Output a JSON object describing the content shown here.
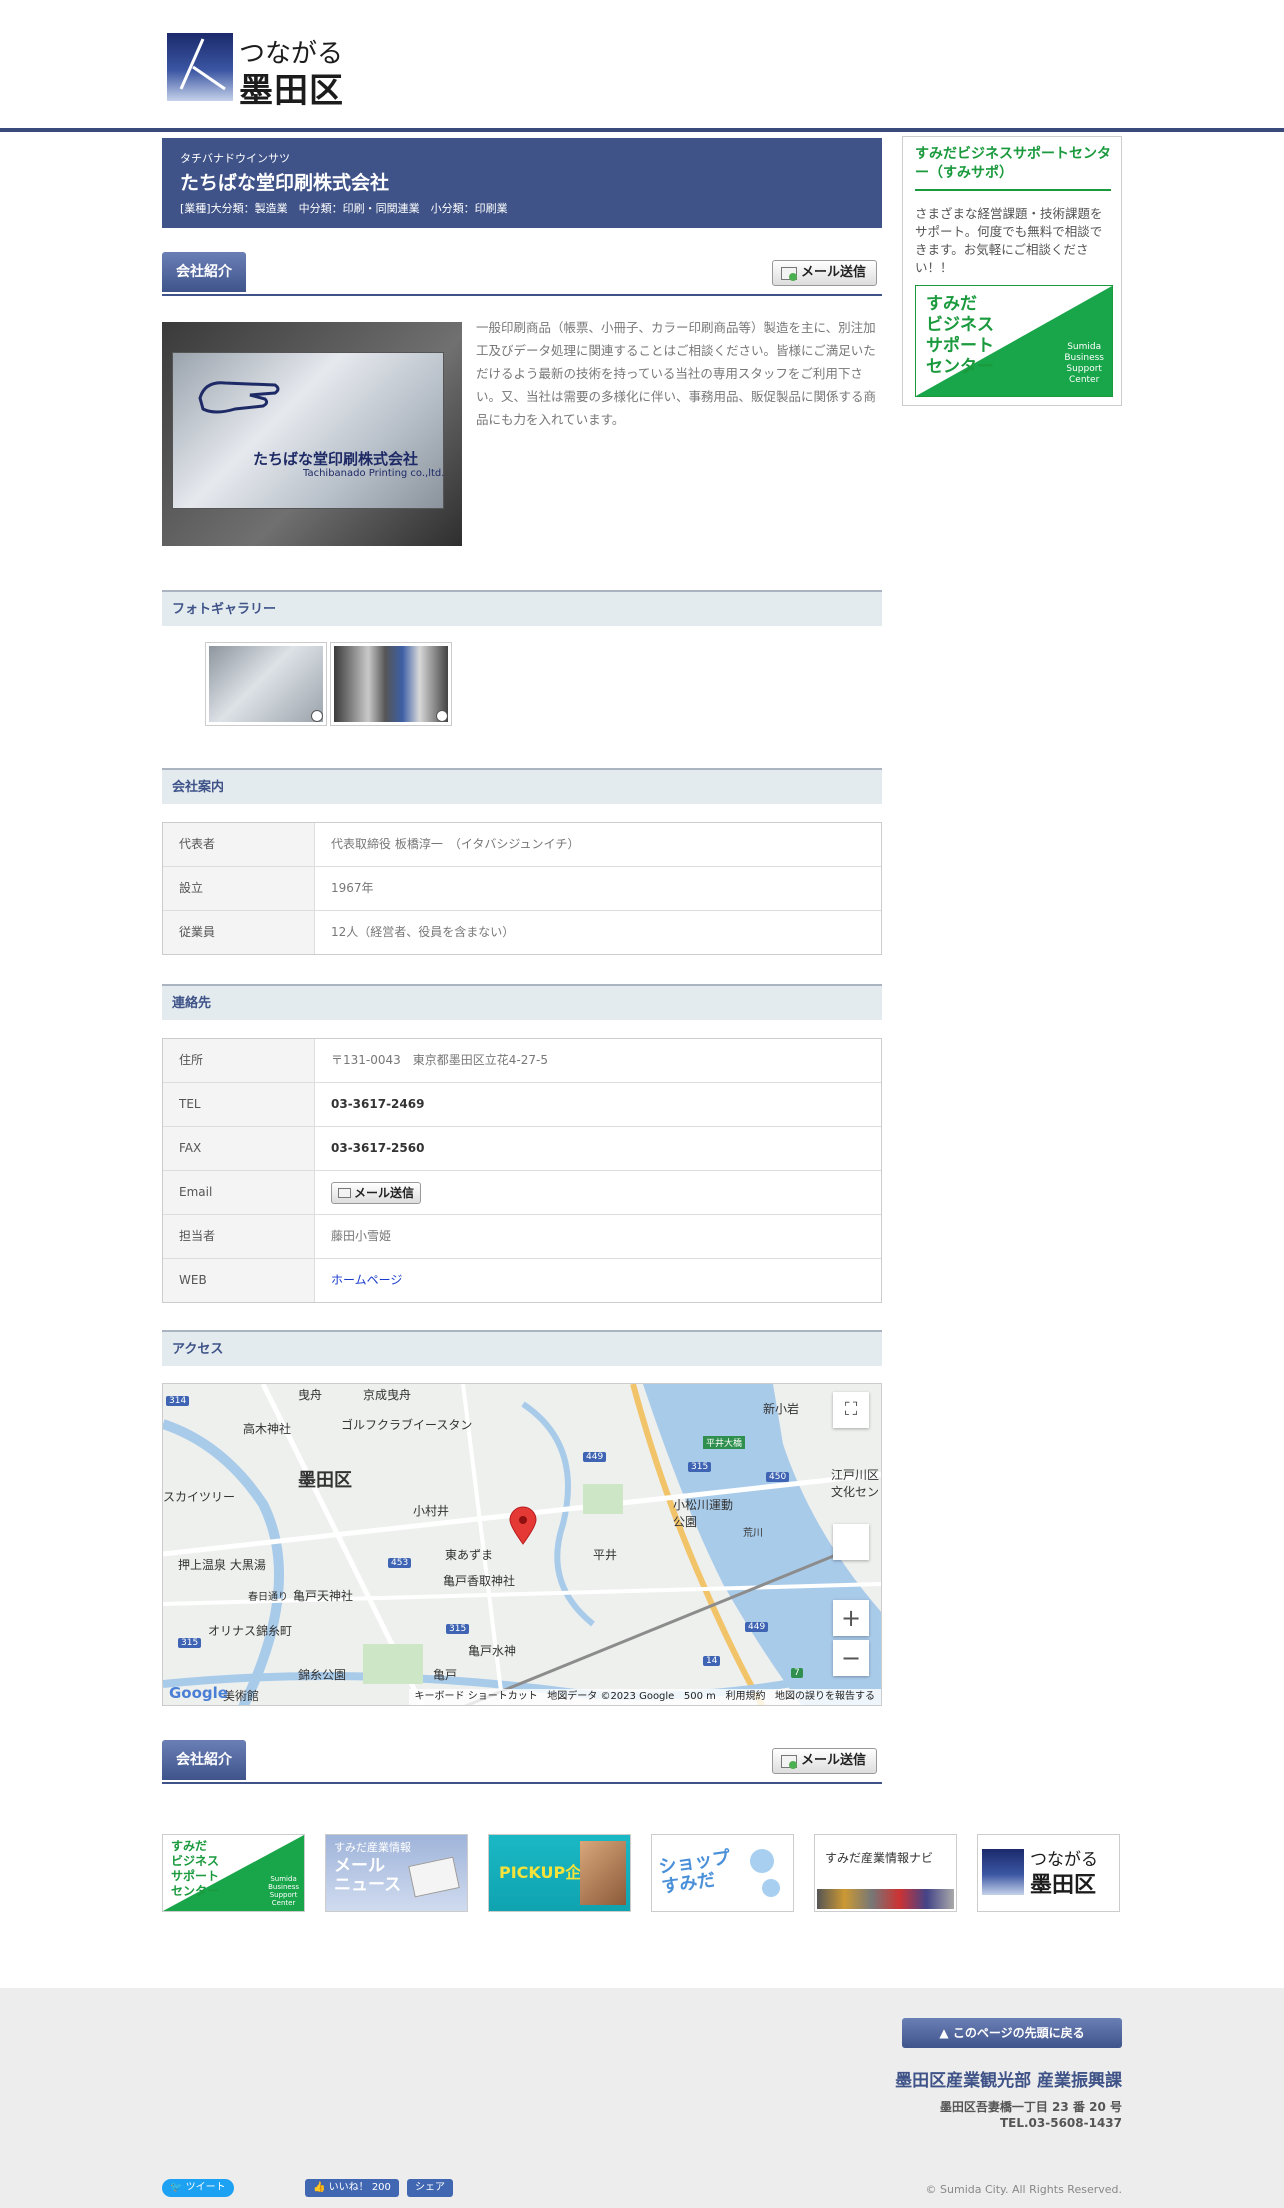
{
  "header": {
    "logo_line1": "つながる",
    "logo_line2": "墨田区"
  },
  "company": {
    "kana": "タチバナドウインサツ",
    "name": "たちばな堂印刷株式会社",
    "industry": "[業種]大分類：製造業　中分類：印刷・同関連業　小分類：印刷業",
    "plate_name": "たちばな堂印刷株式会社",
    "plate_en": "Tachibanado Printing co.,ltd."
  },
  "sections": {
    "intro_tab": "会社紹介",
    "mail_button": "メール送信",
    "gallery": "フォトギャラリー",
    "info": "会社案内",
    "contact": "連絡先",
    "access": "アクセス",
    "intro_tab_bottom": "会社紹介"
  },
  "intro_text": "一般印刷商品（帳票、小冊子、カラー印刷商品等）製造を主に、別注加工及びデータ処理に関連することはご相談ください。皆様にご満足いただけるよう最新の技術を持っている当社の専用スタッフをご利用下さい。又、当社は需要の多様化に伴い、事務用品、販促製品に関係する商品にも力を入れています。",
  "info_table": [
    {
      "label": "代表者",
      "value": "代表取締役 板橋淳一　（イタバシジュンイチ）"
    },
    {
      "label": "設立",
      "value": "1967年"
    },
    {
      "label": "従業員",
      "value": "12人（経営者、役員を含まない）"
    }
  ],
  "contact_table": {
    "address_label": "住所",
    "address": "〒131-0043　東京都墨田区立花4-27-5",
    "tel_label": "TEL",
    "tel": "03-3617-2469",
    "fax_label": "FAX",
    "fax": "03-3617-2560",
    "email_label": "Email",
    "email_button": "メール送信",
    "person_label": "担当者",
    "person": "藤田小雪姫",
    "web_label": "WEB",
    "web": "ホームページ"
  },
  "map": {
    "ward": "墨田区",
    "labels": [
      "曳舟",
      "京成曳舟",
      "ゴルフクラブイースタン",
      "高木神社",
      "スカイツリー",
      "小村井",
      "東あずま",
      "亀戸香取神社",
      "押上温泉 大黒湯",
      "亀戸天神社",
      "春日通り",
      "オリナス錦糸町",
      "錦糸公園",
      "亀戸",
      "亀戸水神",
      "平井",
      "小松川運動公園",
      "新小岩",
      "江戸川区文化セン",
      "荒川",
      "美術館",
      "平井大橋"
    ],
    "road_numbers": [
      "314",
      "449",
      "315",
      "450",
      "453",
      "315",
      "315",
      "449",
      "14",
      "7"
    ],
    "footer_shortcuts": "キーボード ショートカット",
    "footer_data": "地図データ ©2023 Google",
    "footer_scale": "500 m",
    "footer_terms": "利用規約",
    "footer_report": "地図の誤りを報告する",
    "google": "Google",
    "zoom_in": "+",
    "zoom_out": "−",
    "fullscreen": "⛶"
  },
  "sidebar": {
    "title": "すみだビジネスサポートセンター（すみサポ）",
    "text": "さまざまな経営課題・技術課題をサポート。何度でも無料で相談できます。お気軽にご相談ください！！",
    "banner_jp": "すみだ\nビジネス\nサポート\nセンター",
    "banner_en": "Sumida\nBusiness\nSupport\nCenter"
  },
  "banners": {
    "b1_jp": "すみだ\nビジネス\nサポート\nセンター",
    "b1_en": "Sumida\nBusiness\nSupport\nCenter",
    "b2_top": "すみだ産業情報",
    "b2_main": "メール\nニュース",
    "b3": "PICKUP企業",
    "b4": "ショップ\nすみだ",
    "b5": "すみだ産業情報ナビ",
    "b6_line1": "つながる",
    "b6_line2": "墨田区"
  },
  "footer": {
    "to_top": "このページの先頭に戻る",
    "dept": "墨田区産業観光部 産業振興課",
    "address": "墨田区吾妻橋一丁目 23 番 20 号",
    "tel": "TEL.03-5608-1437",
    "copyright": "© Sumida City. All Rights Reserved.",
    "like_count": "いいね！ 200",
    "share": "シェア",
    "tweet": "ツイート"
  },
  "colors": {
    "accent": "#3f5388",
    "green": "#1a9a3d",
    "section_bg": "#e3ebee"
  }
}
